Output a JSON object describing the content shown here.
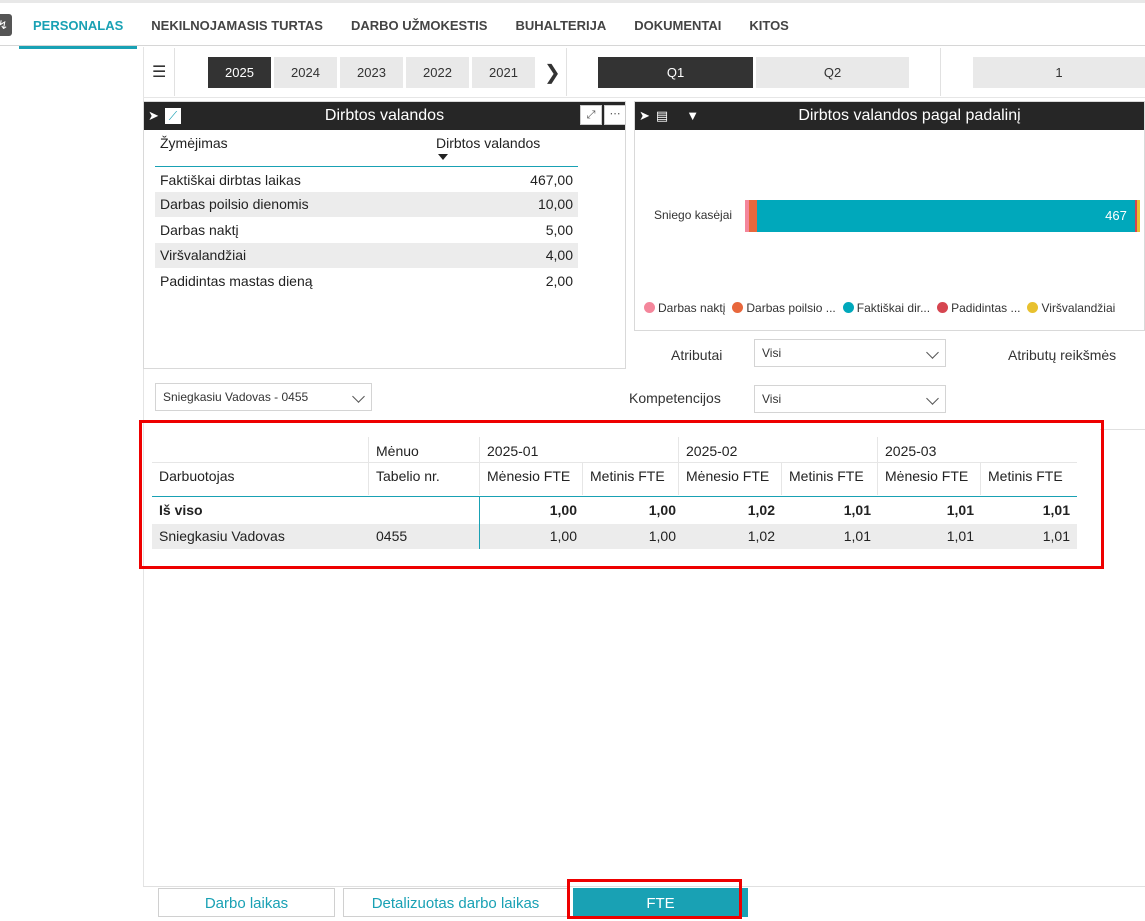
{
  "nav": {
    "items": [
      "PERSONALAS",
      "NEKILNOJAMASIS TURTAS",
      "DARBO UŽMOKESTIS",
      "BUHALTERIJA",
      "DOKUMENTAI",
      "KITOS"
    ],
    "active": "PERSONALAS"
  },
  "slicers": {
    "years": [
      "2025",
      "2024",
      "2023",
      "2022",
      "2021"
    ],
    "selected_year": "2025",
    "quarters": [
      "Q1",
      "Q2"
    ],
    "selected_quarter": "Q1",
    "month": "1"
  },
  "hours_card": {
    "title": "Dirbtos valandos",
    "col_label": "Žymėjimas",
    "col_value": "Dirbtos valandos",
    "rows": [
      {
        "label": "Faktiškai dirbtas laikas",
        "value": "467,00"
      },
      {
        "label": "Darbas poilsio dienomis",
        "value": "10,00"
      },
      {
        "label": "Darbas naktį",
        "value": "5,00"
      },
      {
        "label": "Viršvalandžiai",
        "value": "4,00"
      },
      {
        "label": "Padidintas mastas dieną",
        "value": "2,00"
      }
    ]
  },
  "chart_card": {
    "title": "Dirbtos valandos pagal padalinį"
  },
  "chart_data": {
    "type": "bar",
    "orientation": "horizontal",
    "stacked": true,
    "categories": [
      "Sniego kasėjai"
    ],
    "series": [
      {
        "name": "Darbas naktį",
        "values": [
          5
        ],
        "color": "#f4869b"
      },
      {
        "name": "Darbas poilsio ...",
        "values": [
          10
        ],
        "color": "#e8673c"
      },
      {
        "name": "Faktiškai dir...",
        "values": [
          467
        ],
        "color": "#00a8bb"
      },
      {
        "name": "Padidintas ...",
        "values": [
          2
        ],
        "color": "#d64550"
      },
      {
        "name": "Viršvalandžiai",
        "values": [
          4
        ],
        "color": "#e8c12f"
      }
    ],
    "data_labels": [
      "467"
    ],
    "legend": "bottom",
    "xlim": [
      0,
      488
    ]
  },
  "filters": {
    "atributai_label": "Atributai",
    "atributai_value": "Visi",
    "atributu_reiksmes_label": "Atributų reikšmės",
    "kompetencijos_label": "Kompetencijos",
    "kompetencijos_value": "Visi",
    "employee_value": "Sniegkasiu Vadovas - 0455"
  },
  "matrix": {
    "col_month": "Mėnuo",
    "col_employee": "Darbuotojas",
    "col_tabel": "Tabelio nr.",
    "months": [
      "2025-01",
      "2025-02",
      "2025-03"
    ],
    "sub_monthly": "Mėnesio FTE",
    "sub_yearly": "Metinis FTE",
    "total_label": "Iš viso",
    "total_values": [
      "1,00",
      "1,00",
      "1,02",
      "1,01",
      "1,01",
      "1,01"
    ],
    "row_name": "Sniegkasiu Vadovas",
    "row_tabel": "0455",
    "row_values": [
      "1,00",
      "1,00",
      "1,02",
      "1,01",
      "1,01",
      "1,01"
    ]
  },
  "tabs": {
    "items": [
      "Darbo laikas",
      "Detalizuotas darbo laikas",
      "FTE"
    ],
    "active": "FTE"
  },
  "colors": {
    "accent": "#19a1b4",
    "highlight": "#ee0000"
  }
}
